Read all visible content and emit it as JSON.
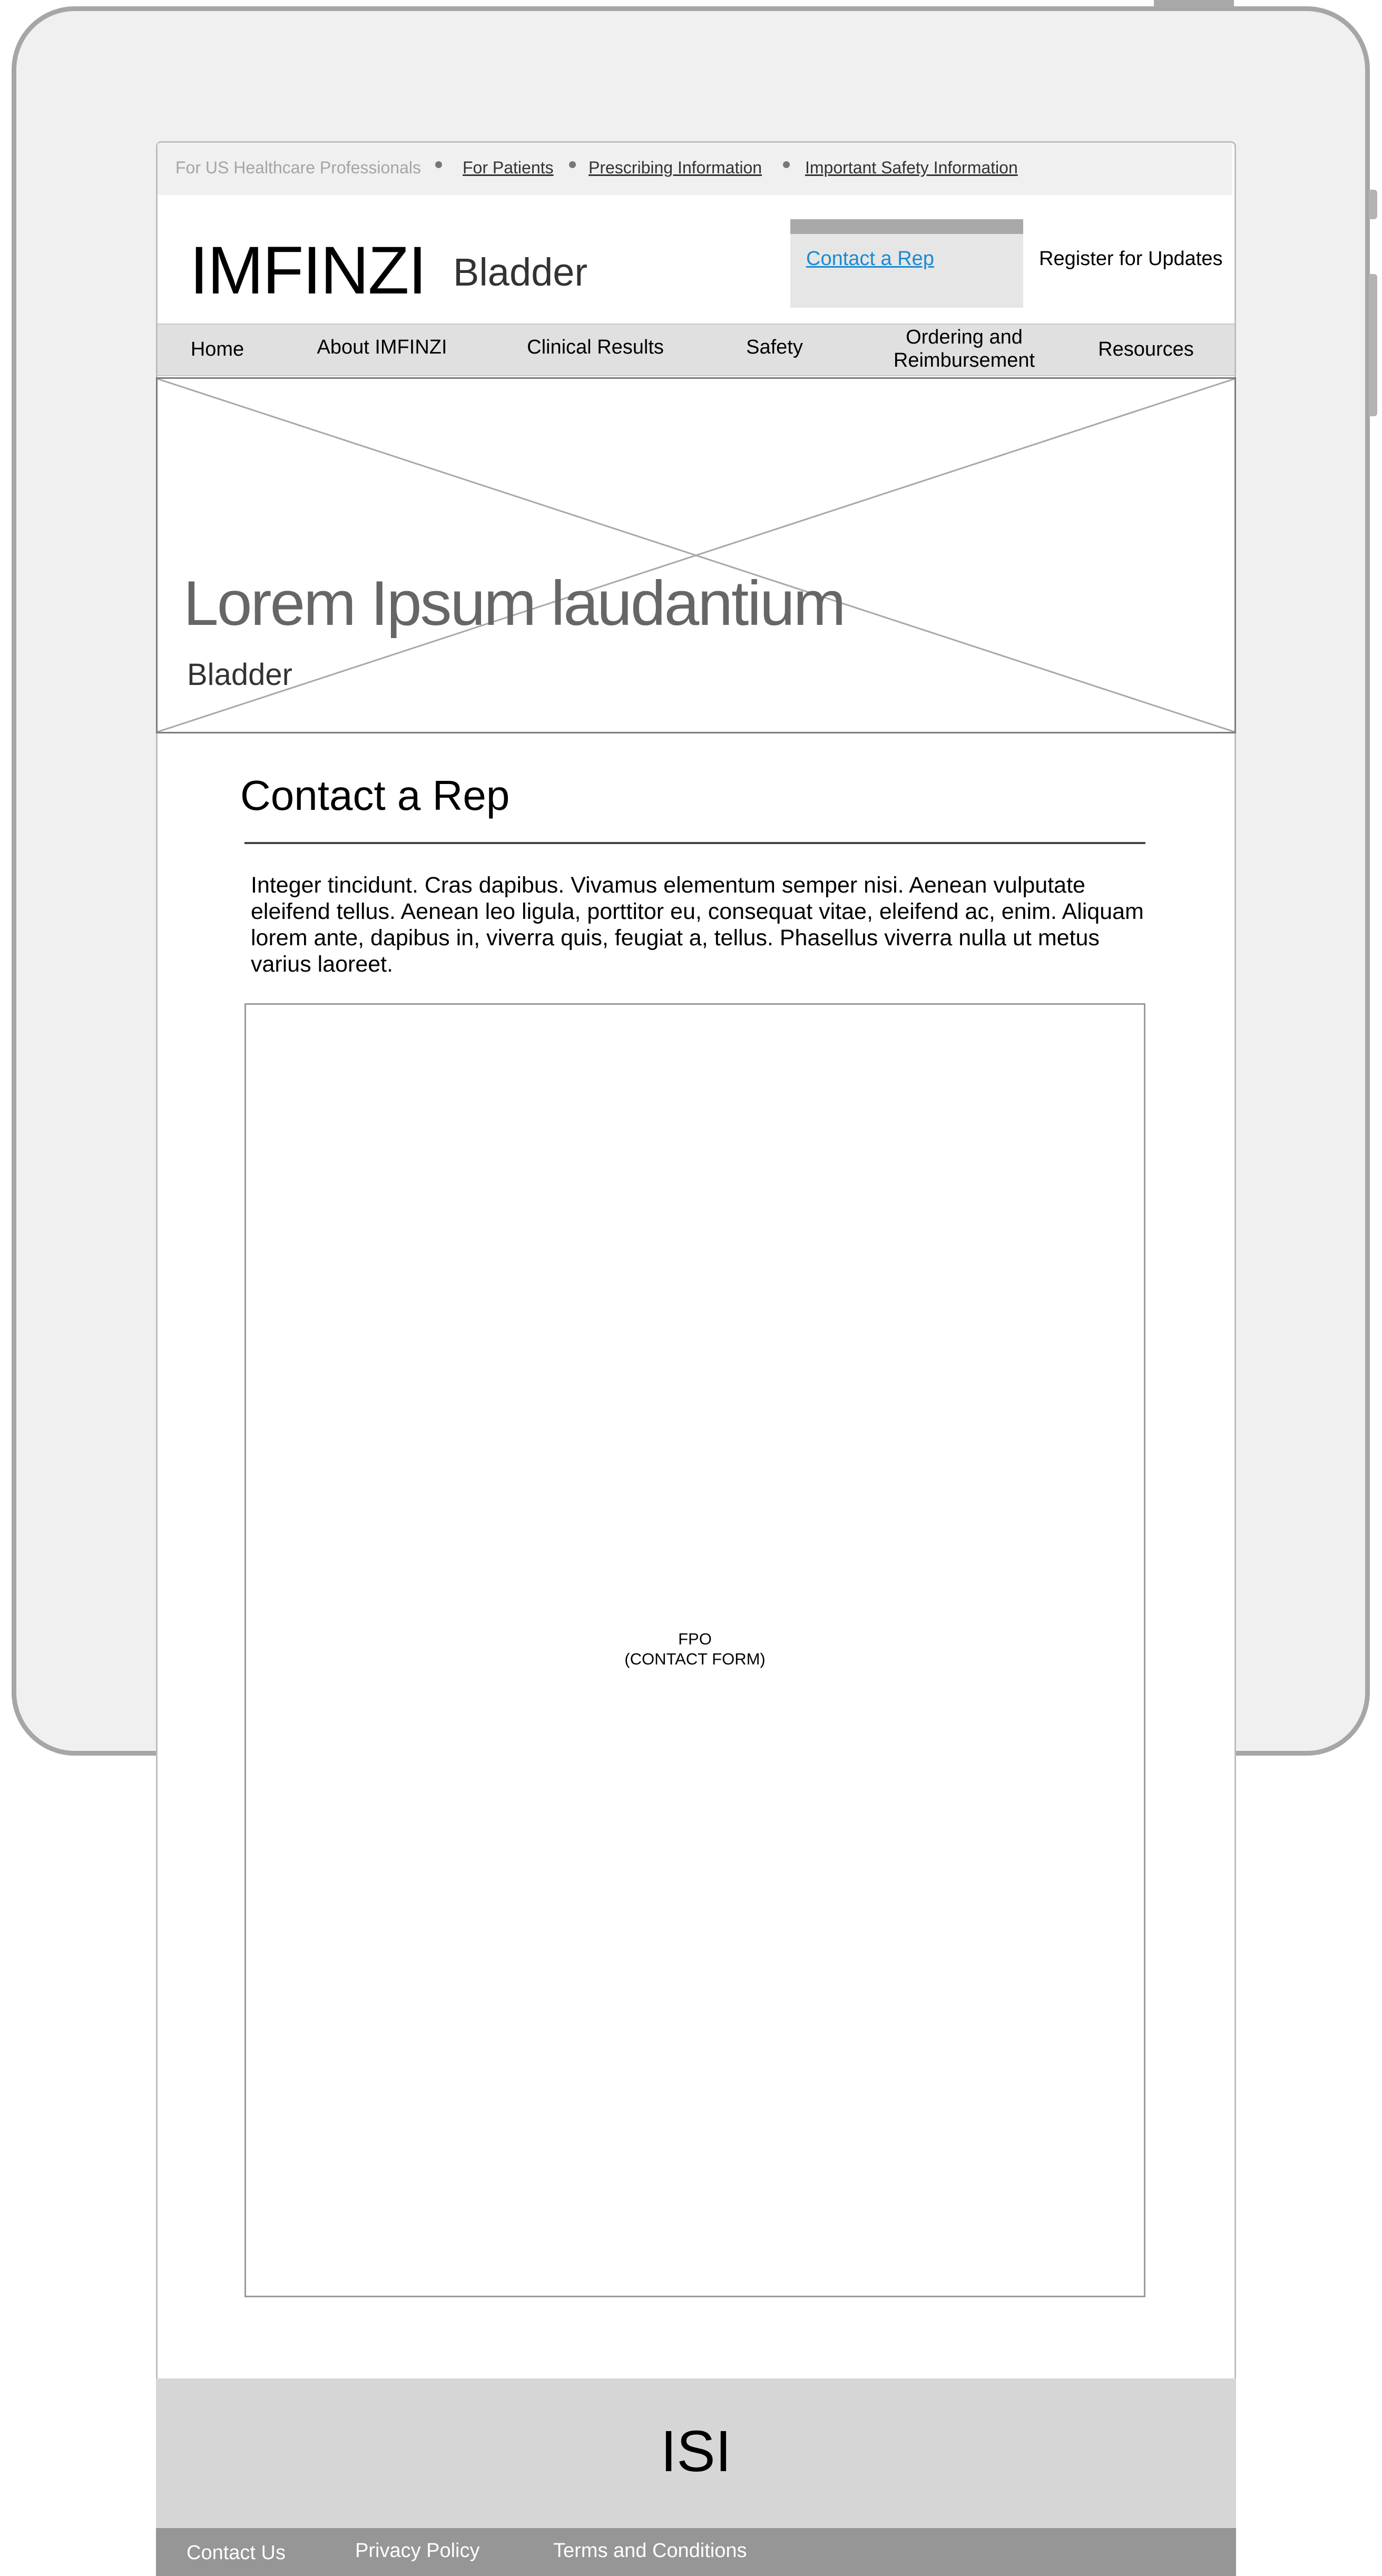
{
  "utility": {
    "audience": "For US Healthcare Professionals",
    "links": [
      "For Patients",
      "Prescribing Information",
      "Important Safety Information"
    ]
  },
  "header": {
    "brand": "IMFINZI",
    "indication": "Bladder",
    "contact_rep": "Contact a Rep",
    "register": "Register for Updates"
  },
  "nav": {
    "items": [
      "Home",
      "About IMFINZI",
      "Clinical Results",
      "Safety",
      "Ordering and Reimbursement",
      "Resources"
    ]
  },
  "hero": {
    "title": "Lorem Ipsum laudantium",
    "subtitle": "Bladder"
  },
  "main": {
    "title": "Contact a Rep",
    "body": "Integer tincidunt. Cras dapibus. Vivamus elementum semper nisi. Aenean vulputate eleifend tellus. Aenean leo ligula, porttitor eu, consequat vitae, eleifend ac, enim. Aliquam lorem ante, dapibus in, viverra quis, feugiat a, tellus. Phasellus viverra nulla ut metus varius laoreet.",
    "form_placeholder_line1": "FPO",
    "form_placeholder_line2": "(CONTACT FORM)"
  },
  "isi": {
    "label": "ISI"
  },
  "footer": {
    "links": [
      "Contact Us",
      "Privacy Policy",
      "Terms and Conditions"
    ]
  }
}
